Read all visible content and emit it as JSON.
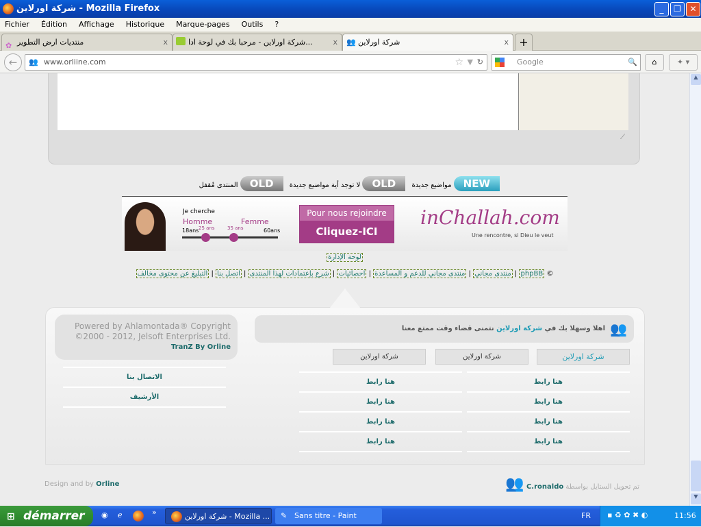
{
  "window": {
    "title": "شركة اورلاين - Mozilla Firefox"
  },
  "menu": [
    "Fichier",
    "Édition",
    "Affichage",
    "Historique",
    "Marque-pages",
    "Outils",
    "?"
  ],
  "tabs": [
    {
      "label": "منتديات ارض التطوير"
    },
    {
      "label": "شركة اورلاين - مرحبا بك في لوحة ادا..."
    },
    {
      "label": "شركة اورلاين",
      "active": true
    }
  ],
  "nav": {
    "url": "www.orliine.com",
    "search_placeholder": "Google"
  },
  "legend": {
    "new_badge": "NEW",
    "new_label": "مواضيع جديدة",
    "old_badge": "OLD",
    "old_label": "لا توجد أية مواضيع جديدة",
    "locked_badge": "OLD",
    "locked_label": "المنتدى مُقفل"
  },
  "banner": {
    "looking": "Je cherche",
    "homme": "Homme",
    "femme": "Femme",
    "age_min": "18ans",
    "age_a": "25 ans",
    "age_b": "35 ans",
    "age_max": "60ans",
    "cta_top": "Pour nous rejoindre",
    "cta_bottom": "Cliquez-ICI",
    "logo": "inChallah.com",
    "tagline": "Une rencontre, si Dieu le veut"
  },
  "admin_link": "لوحة الإدارة",
  "footer_links": [
    "phpBB",
    "منتدى مجاني",
    "منتدى مجاني للدعم و المساعدة",
    "احصائيات",
    "شرع بإعتمادات لهذا المنتدى",
    "اتصل بنا",
    "التبليغ عن محتوى مخالف"
  ],
  "copyright_symbol": "©",
  "footer": {
    "powered": "Powered by Ahlamontada® Copyright ©2000 - 2012, Jelsoft Enterprises Ltd.",
    "tranz": "TranZ By Orline",
    "welcome_pre": "اهلا وسهلا بك في",
    "welcome_name": "شركة اورلاين",
    "welcome_post": "نتمنى قضاء وقت ممتع معنا",
    "tabs": [
      "شركة اورلاين",
      "شركة اورلاين",
      "شركة اورلاين"
    ],
    "left_links": [
      "الاتصال بنا",
      "الأرشيف"
    ],
    "col_links": [
      "هنا رابط",
      "هنا رابط",
      "هنا رابط",
      "هنا رابط"
    ],
    "design_by": "Design and by",
    "design_name": "Orline",
    "converted_by": "تم تحويل الستايل بواسطة",
    "converter": "C.ronaldo"
  },
  "taskbar": {
    "start": "démarrer",
    "items": [
      "شركة اورلاين - Mozilla ...",
      "Sans titre - Paint"
    ],
    "lang": "FR",
    "clock": "11:56"
  },
  "colors": {
    "accent": "#1f7a6e",
    "link_teal": "#1d9bb5",
    "banner_pink": "#a33c86"
  }
}
